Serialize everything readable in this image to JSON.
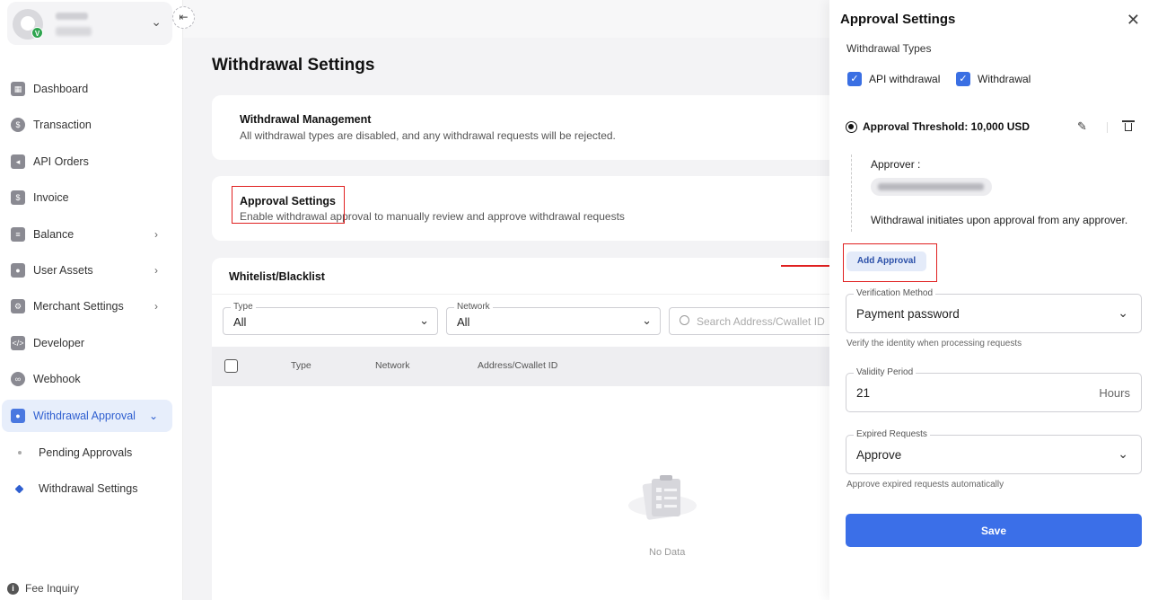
{
  "sidebar": {
    "items": [
      {
        "label": "Dashboard",
        "icon": "dashboard-icon"
      },
      {
        "label": "Transaction",
        "icon": "transaction-icon"
      },
      {
        "label": "API Orders",
        "icon": "api-orders-icon"
      },
      {
        "label": "Invoice",
        "icon": "invoice-icon"
      },
      {
        "label": "Balance",
        "icon": "balance-icon"
      },
      {
        "label": "User Assets",
        "icon": "user-assets-icon"
      },
      {
        "label": "Merchant Settings",
        "icon": "merchant-settings-icon"
      },
      {
        "label": "Developer",
        "icon": "developer-icon"
      },
      {
        "label": "Webhook",
        "icon": "webhook-icon"
      },
      {
        "label": "Withdrawal Approval",
        "icon": "withdrawal-approval-icon"
      }
    ],
    "sub_items": [
      {
        "label": "Pending Approvals"
      },
      {
        "label": "Withdrawal Settings"
      }
    ],
    "fee_inquiry": "Fee Inquiry",
    "account_badge": "V"
  },
  "main": {
    "title": "Withdrawal Settings",
    "withdrawal_management": {
      "title": "Withdrawal Management",
      "desc": "All withdrawal types are disabled, and any withdrawal requests will be rejected."
    },
    "approval_settings": {
      "title": "Approval Settings",
      "desc": "Enable withdrawal approval to manually review and approve withdrawal requests"
    },
    "whitelist": {
      "title": "Whitelist/Blacklist",
      "type_label": "Type",
      "type_value": "All",
      "network_label": "Network",
      "network_value": "All",
      "search_placeholder": "Search Address/Cwallet ID",
      "columns": [
        "Type",
        "Network",
        "Address/Cwallet ID"
      ],
      "empty_text": "No Data"
    }
  },
  "drawer": {
    "title": "Approval Settings",
    "withdrawal_types_label": "Withdrawal Types",
    "types": [
      {
        "label": "API withdrawal",
        "checked": true
      },
      {
        "label": "Withdrawal",
        "checked": true
      }
    ],
    "threshold_label": "Approval Threshold: 10,000 USD",
    "approver_label": "Approver :",
    "approver_note": "Withdrawal initiates upon approval from any approver.",
    "add_approval": "Add Approval",
    "verification_method": {
      "label": "Verification Method",
      "value": "Payment password",
      "hint": "Verify the identity when processing requests"
    },
    "validity_period": {
      "label": "Validity Period",
      "value": "21",
      "suffix": "Hours"
    },
    "expired_requests": {
      "label": "Expired Requests",
      "value": "Approve",
      "hint": "Approve expired requests automatically"
    },
    "save": "Save"
  },
  "colors": {
    "primary": "#3b6fe8",
    "active_nav_bg": "#e7eefb",
    "annotation_red": "#e02020"
  }
}
